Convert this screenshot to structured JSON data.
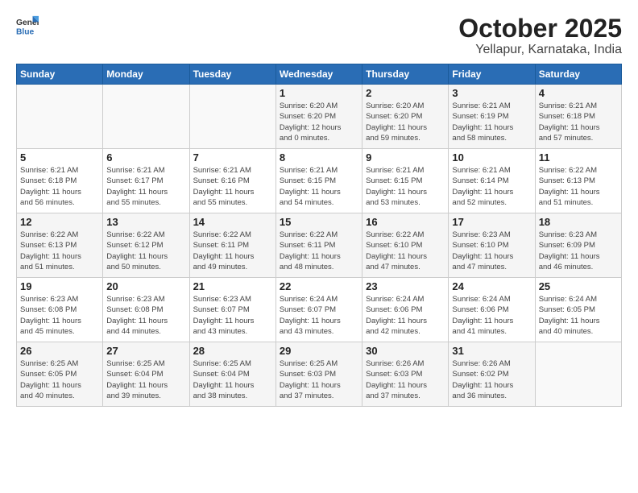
{
  "logo": {
    "text_general": "General",
    "text_blue": "Blue"
  },
  "header": {
    "title": "October 2025",
    "subtitle": "Yellapur, Karnataka, India"
  },
  "weekdays": [
    "Sunday",
    "Monday",
    "Tuesday",
    "Wednesday",
    "Thursday",
    "Friday",
    "Saturday"
  ],
  "weeks": [
    [
      {
        "day": "",
        "info": ""
      },
      {
        "day": "",
        "info": ""
      },
      {
        "day": "",
        "info": ""
      },
      {
        "day": "1",
        "info": "Sunrise: 6:20 AM\nSunset: 6:20 PM\nDaylight: 12 hours\nand 0 minutes."
      },
      {
        "day": "2",
        "info": "Sunrise: 6:20 AM\nSunset: 6:20 PM\nDaylight: 11 hours\nand 59 minutes."
      },
      {
        "day": "3",
        "info": "Sunrise: 6:21 AM\nSunset: 6:19 PM\nDaylight: 11 hours\nand 58 minutes."
      },
      {
        "day": "4",
        "info": "Sunrise: 6:21 AM\nSunset: 6:18 PM\nDaylight: 11 hours\nand 57 minutes."
      }
    ],
    [
      {
        "day": "5",
        "info": "Sunrise: 6:21 AM\nSunset: 6:18 PM\nDaylight: 11 hours\nand 56 minutes."
      },
      {
        "day": "6",
        "info": "Sunrise: 6:21 AM\nSunset: 6:17 PM\nDaylight: 11 hours\nand 55 minutes."
      },
      {
        "day": "7",
        "info": "Sunrise: 6:21 AM\nSunset: 6:16 PM\nDaylight: 11 hours\nand 55 minutes."
      },
      {
        "day": "8",
        "info": "Sunrise: 6:21 AM\nSunset: 6:15 PM\nDaylight: 11 hours\nand 54 minutes."
      },
      {
        "day": "9",
        "info": "Sunrise: 6:21 AM\nSunset: 6:15 PM\nDaylight: 11 hours\nand 53 minutes."
      },
      {
        "day": "10",
        "info": "Sunrise: 6:21 AM\nSunset: 6:14 PM\nDaylight: 11 hours\nand 52 minutes."
      },
      {
        "day": "11",
        "info": "Sunrise: 6:22 AM\nSunset: 6:13 PM\nDaylight: 11 hours\nand 51 minutes."
      }
    ],
    [
      {
        "day": "12",
        "info": "Sunrise: 6:22 AM\nSunset: 6:13 PM\nDaylight: 11 hours\nand 51 minutes."
      },
      {
        "day": "13",
        "info": "Sunrise: 6:22 AM\nSunset: 6:12 PM\nDaylight: 11 hours\nand 50 minutes."
      },
      {
        "day": "14",
        "info": "Sunrise: 6:22 AM\nSunset: 6:11 PM\nDaylight: 11 hours\nand 49 minutes."
      },
      {
        "day": "15",
        "info": "Sunrise: 6:22 AM\nSunset: 6:11 PM\nDaylight: 11 hours\nand 48 minutes."
      },
      {
        "day": "16",
        "info": "Sunrise: 6:22 AM\nSunset: 6:10 PM\nDaylight: 11 hours\nand 47 minutes."
      },
      {
        "day": "17",
        "info": "Sunrise: 6:23 AM\nSunset: 6:10 PM\nDaylight: 11 hours\nand 47 minutes."
      },
      {
        "day": "18",
        "info": "Sunrise: 6:23 AM\nSunset: 6:09 PM\nDaylight: 11 hours\nand 46 minutes."
      }
    ],
    [
      {
        "day": "19",
        "info": "Sunrise: 6:23 AM\nSunset: 6:08 PM\nDaylight: 11 hours\nand 45 minutes."
      },
      {
        "day": "20",
        "info": "Sunrise: 6:23 AM\nSunset: 6:08 PM\nDaylight: 11 hours\nand 44 minutes."
      },
      {
        "day": "21",
        "info": "Sunrise: 6:23 AM\nSunset: 6:07 PM\nDaylight: 11 hours\nand 43 minutes."
      },
      {
        "day": "22",
        "info": "Sunrise: 6:24 AM\nSunset: 6:07 PM\nDaylight: 11 hours\nand 43 minutes."
      },
      {
        "day": "23",
        "info": "Sunrise: 6:24 AM\nSunset: 6:06 PM\nDaylight: 11 hours\nand 42 minutes."
      },
      {
        "day": "24",
        "info": "Sunrise: 6:24 AM\nSunset: 6:06 PM\nDaylight: 11 hours\nand 41 minutes."
      },
      {
        "day": "25",
        "info": "Sunrise: 6:24 AM\nSunset: 6:05 PM\nDaylight: 11 hours\nand 40 minutes."
      }
    ],
    [
      {
        "day": "26",
        "info": "Sunrise: 6:25 AM\nSunset: 6:05 PM\nDaylight: 11 hours\nand 40 minutes."
      },
      {
        "day": "27",
        "info": "Sunrise: 6:25 AM\nSunset: 6:04 PM\nDaylight: 11 hours\nand 39 minutes."
      },
      {
        "day": "28",
        "info": "Sunrise: 6:25 AM\nSunset: 6:04 PM\nDaylight: 11 hours\nand 38 minutes."
      },
      {
        "day": "29",
        "info": "Sunrise: 6:25 AM\nSunset: 6:03 PM\nDaylight: 11 hours\nand 37 minutes."
      },
      {
        "day": "30",
        "info": "Sunrise: 6:26 AM\nSunset: 6:03 PM\nDaylight: 11 hours\nand 37 minutes."
      },
      {
        "day": "31",
        "info": "Sunrise: 6:26 AM\nSunset: 6:02 PM\nDaylight: 11 hours\nand 36 minutes."
      },
      {
        "day": "",
        "info": ""
      }
    ]
  ]
}
